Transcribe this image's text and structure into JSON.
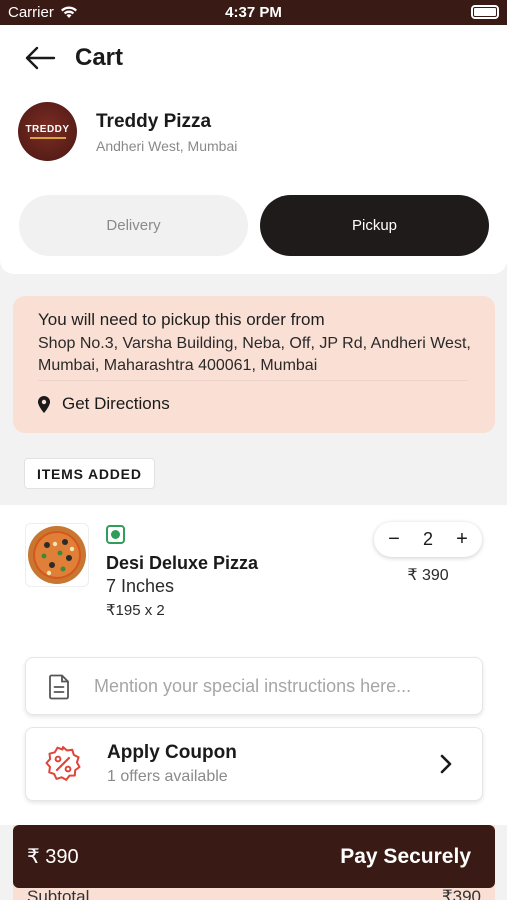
{
  "status_bar": {
    "carrier": "Carrier",
    "time": "4:37 PM"
  },
  "header": {
    "title": "Cart"
  },
  "restaurant": {
    "logo_text": "TREDDY",
    "name": "Treddy Pizza",
    "location": "Andheri West, Mumbai"
  },
  "order_type": {
    "delivery_label": "Delivery",
    "pickup_label": "Pickup",
    "selected": "Pickup"
  },
  "pickup_info": {
    "title": "You will need to pickup this order from",
    "address": "Shop No.3, Varsha Building, Neba, Off, JP Rd, Andheri West, Mumbai, Maharashtra 400061, Mumbai",
    "directions_label": "Get Directions"
  },
  "items_section": {
    "badge": "ITEMS ADDED",
    "items": [
      {
        "name": "Desi Deluxe Pizza",
        "size": "7 Inches",
        "unit_price_text": "₹195 x 2",
        "quantity": "2",
        "price": "₹ 390",
        "veg": true
      }
    ]
  },
  "instructions": {
    "placeholder": "Mention your special instructions here..."
  },
  "coupon": {
    "title": "Apply Coupon",
    "subtitle": "1 offers available"
  },
  "summary": {
    "subtotal_label": "Subtotal",
    "subtotal_value": "₹390"
  },
  "pay_bar": {
    "total": "₹ 390",
    "label": "Pay Securely"
  },
  "colors": {
    "brand_dark": "#3a1a14",
    "pickup_bg": "#f9dfd4",
    "toggle_active": "#1f1b1b",
    "veg_green": "#2f9e5b",
    "coupon_red": "#e0453a"
  }
}
